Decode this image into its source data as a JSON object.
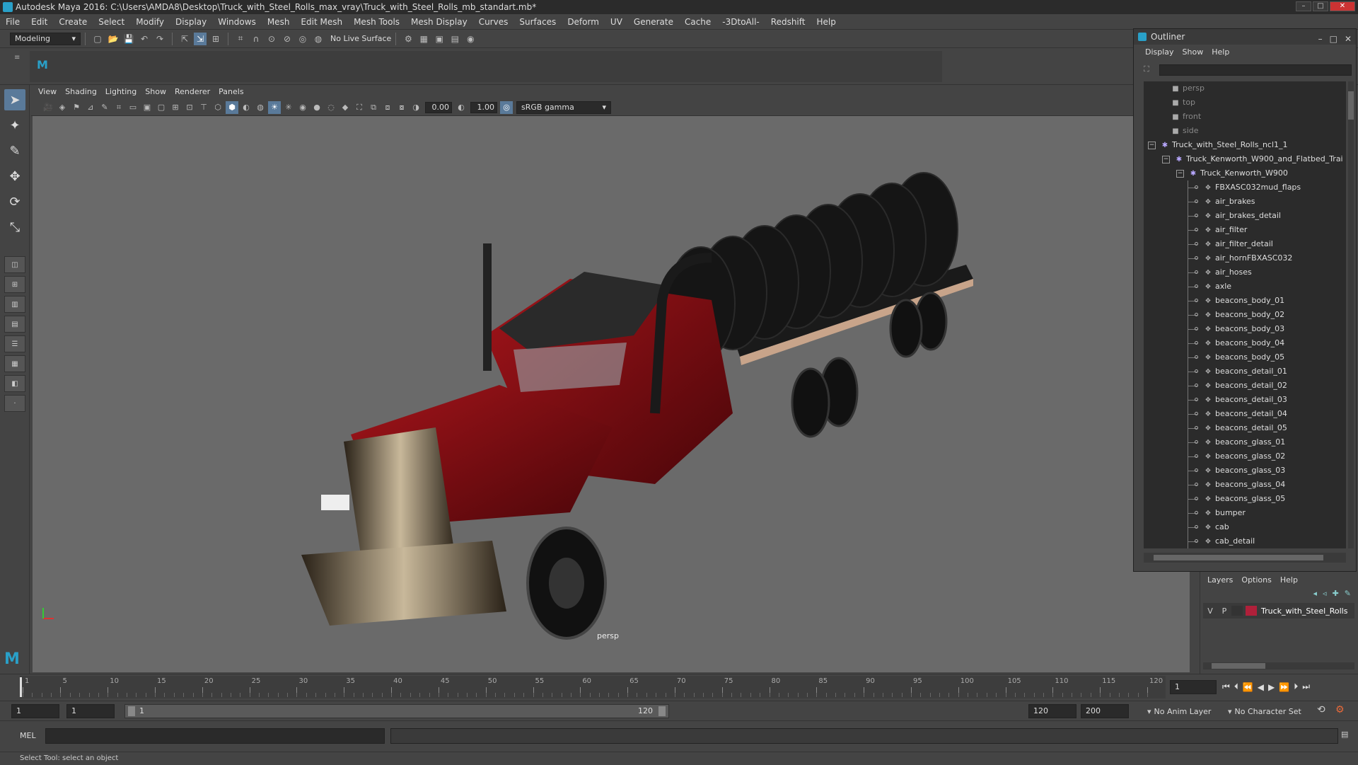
{
  "title": "Autodesk Maya 2016: C:\\Users\\AMDA8\\Desktop\\Truck_with_Steel_Rolls_max_vray\\Truck_with_Steel_Rolls_mb_standart.mb*",
  "menu": [
    "File",
    "Edit",
    "Create",
    "Select",
    "Modify",
    "Display",
    "Windows",
    "Mesh",
    "Edit Mesh",
    "Mesh Tools",
    "Mesh Display",
    "Curves",
    "Surfaces",
    "Deform",
    "UV",
    "Generate",
    "Cache",
    "-3DtoAll-",
    "Redshift",
    "Help"
  ],
  "status": {
    "mode": "Modeling",
    "live_surface": "No Live Surface"
  },
  "viewport": {
    "menu": [
      "View",
      "Shading",
      "Lighting",
      "Show",
      "Renderer",
      "Panels"
    ],
    "exposure": "0.00",
    "gamma": "1.00",
    "color_space": "sRGB gamma",
    "camera": "persp"
  },
  "outliner": {
    "title": "Outliner",
    "menu": [
      "Display",
      "Show",
      "Help"
    ],
    "cameras": [
      "persp",
      "top",
      "front",
      "side"
    ],
    "root": "Truck_with_Steel_Rolls_ncl1_1",
    "group1": "Truck_Kenworth_W900_and_Flatbed_Trai",
    "group2": "Truck_Kenworth_W900",
    "items": [
      "FBXASC032mud_flaps",
      "air_brakes",
      "air_brakes_detail",
      "air_filter",
      "air_filter_detail",
      "air_hornFBXASC032",
      "air_hoses",
      "axle",
      "beacons_body_01",
      "beacons_body_02",
      "beacons_body_03",
      "beacons_body_04",
      "beacons_body_05",
      "beacons_detail_01",
      "beacons_detail_02",
      "beacons_detail_03",
      "beacons_detail_04",
      "beacons_detail_05",
      "beacons_glass_01",
      "beacons_glass_02",
      "beacons_glass_03",
      "beacons_glass_04",
      "beacons_glass_05",
      "bumper",
      "cab",
      "cab_detail"
    ]
  },
  "layers": {
    "menu": [
      "Layers",
      "Options",
      "Help"
    ],
    "layer": {
      "v": "V",
      "p": "P",
      "name": "Truck_with_Steel_Rolls",
      "color": "#b0203a"
    }
  },
  "timeline": {
    "ticks": [
      "1",
      "5",
      "10",
      "15",
      "20",
      "25",
      "30",
      "35",
      "40",
      "45",
      "50",
      "55",
      "60",
      "65",
      "70",
      "75",
      "80",
      "85",
      "90",
      "95",
      "100",
      "105",
      "110",
      "115",
      "120"
    ],
    "current_frame": "1"
  },
  "range": {
    "start": "1",
    "start2": "1",
    "slider_start": "1",
    "slider_end": "120",
    "end": "120",
    "end2": "200",
    "anim_layer": "No Anim Layer",
    "character_set": "No Character Set"
  },
  "cmdline": {
    "label": "MEL"
  },
  "helpline": "Select Tool: select an object",
  "colors": {
    "accent": "#5a7a9a",
    "truck_red": "#8a0f14"
  }
}
